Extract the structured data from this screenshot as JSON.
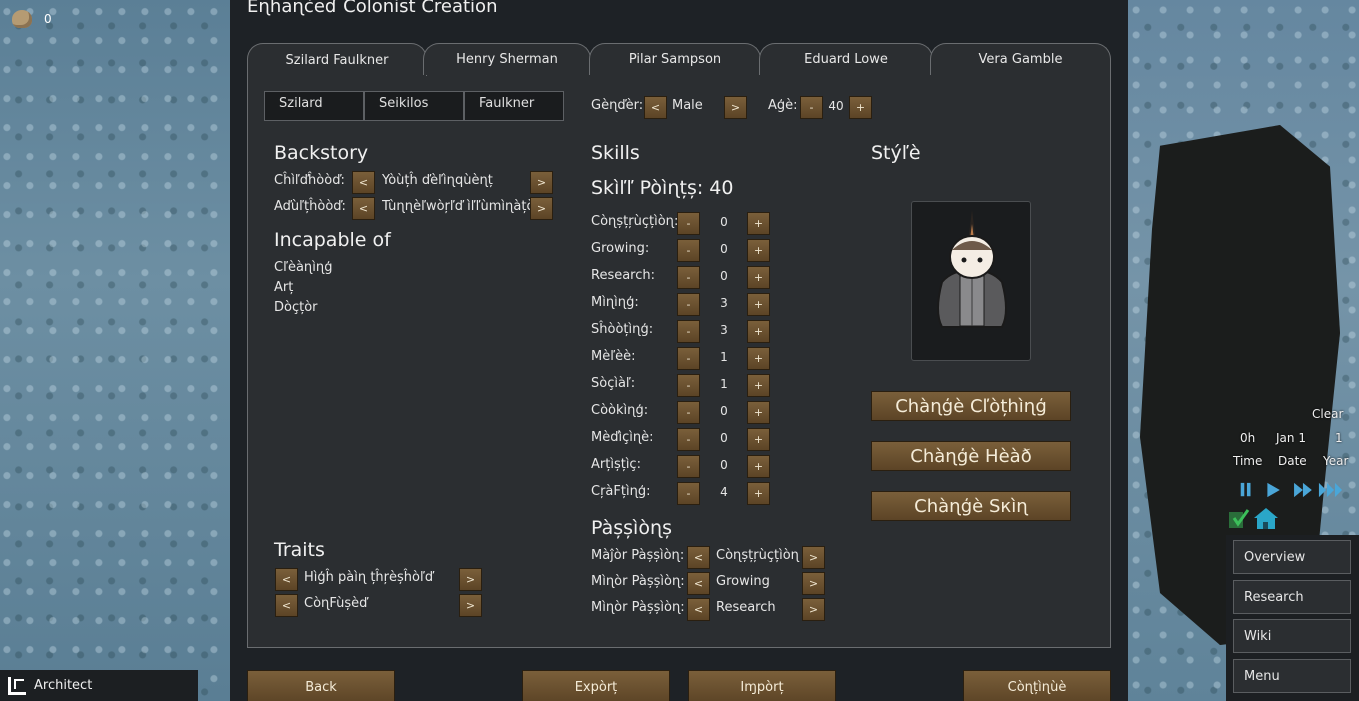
{
  "hud": {
    "resource_count": "0",
    "weather": "Clear",
    "time_value": "0h",
    "date_value": "Jan 1",
    "year_value": "1",
    "time_label": "Time",
    "date_label": "Date",
    "year_label": "Year",
    "architect_label": "Architect",
    "menu": [
      "Overview",
      "Research",
      "Wiki",
      "Menu"
    ]
  },
  "dialog": {
    "title": "Eɳĥaɳċeɗ Colonist Creation",
    "tabs": [
      "Szilard Faulkner",
      "Henry Sherman",
      "Pilar Sampson",
      "Eduard Lowe",
      "Vera Gamble"
    ],
    "name_fields": {
      "first": "Szilard",
      "nick": "Seikilos",
      "last": "Faulkner"
    },
    "gender_label": "Gèɳďèr:",
    "gender_value": "Male",
    "age_label": "Aģè:",
    "age_value": "40",
    "backstory": {
      "header": "Backstory",
      "childhood_label": "Cĥìľďĥòòď:",
      "childhood_value": "Yòùțĥ ďèľìɳqùèɳț",
      "adulthood_label": "Aďùľțĥòòď:",
      "adulthood_value": "Tùɳɳèľwòŗľď ìľľùmìɳàțòr"
    },
    "incapable": {
      "header": "Incapable of",
      "items": [
        "Cľèàɳìɳģ",
        "Arț",
        "Dòçțòr"
      ]
    },
    "traits": {
      "header": "Traits",
      "items": [
        "Hìģĥ pàìɳ țĥŗèșĥòľď",
        "CòɳFùșèď"
      ]
    },
    "skills": {
      "header": "Skills",
      "points_label": "Skìľľ Pòìɳțș: 40",
      "rows": [
        {
          "name": "Còɳșțŗùçțìòɳ:",
          "value": "0"
        },
        {
          "name": "Growing:",
          "value": "0"
        },
        {
          "name": "Research:",
          "value": "0"
        },
        {
          "name": "Mìɳìɳģ:",
          "value": "3"
        },
        {
          "name": "Sĥòòțìɳģ:",
          "value": "3"
        },
        {
          "name": "Mèľèè:",
          "value": "1"
        },
        {
          "name": "Sòçìàľ:",
          "value": "1"
        },
        {
          "name": "Còòkìɳģ:",
          "value": "0"
        },
        {
          "name": "Mèďìçìɳè:",
          "value": "0"
        },
        {
          "name": "Arțìșțìç:",
          "value": "0"
        },
        {
          "name": "CŗàFțìɳģ:",
          "value": "4"
        }
      ]
    },
    "passions": {
      "header": "Pàșșìòɳș",
      "rows": [
        {
          "label": "Màĵòr Pàșșìòɳ:",
          "value": "Còɳșțŗùçțìòɳ"
        },
        {
          "label": "Mìɳòr Pàșșìòɳ:",
          "value": "Growing"
        },
        {
          "label": "Mìɳòr Pàșșìòɳ:",
          "value": "Research"
        }
      ]
    },
    "style": {
      "header": "Stýľè",
      "change_clothing": "Chàɳģè Cľòțhìɳģ",
      "change_head": "Chàɳģè Hèàð",
      "change_skin": "Chàɳģè Sкìɳ"
    },
    "buttons": {
      "back": "Back",
      "export": "Expòrț",
      "import": "Iɱpòrț",
      "continue": "Còɳțìɳùè"
    },
    "glyphs": {
      "prev": "<",
      "next": ">",
      "minus": "-",
      "plus": "+"
    }
  }
}
